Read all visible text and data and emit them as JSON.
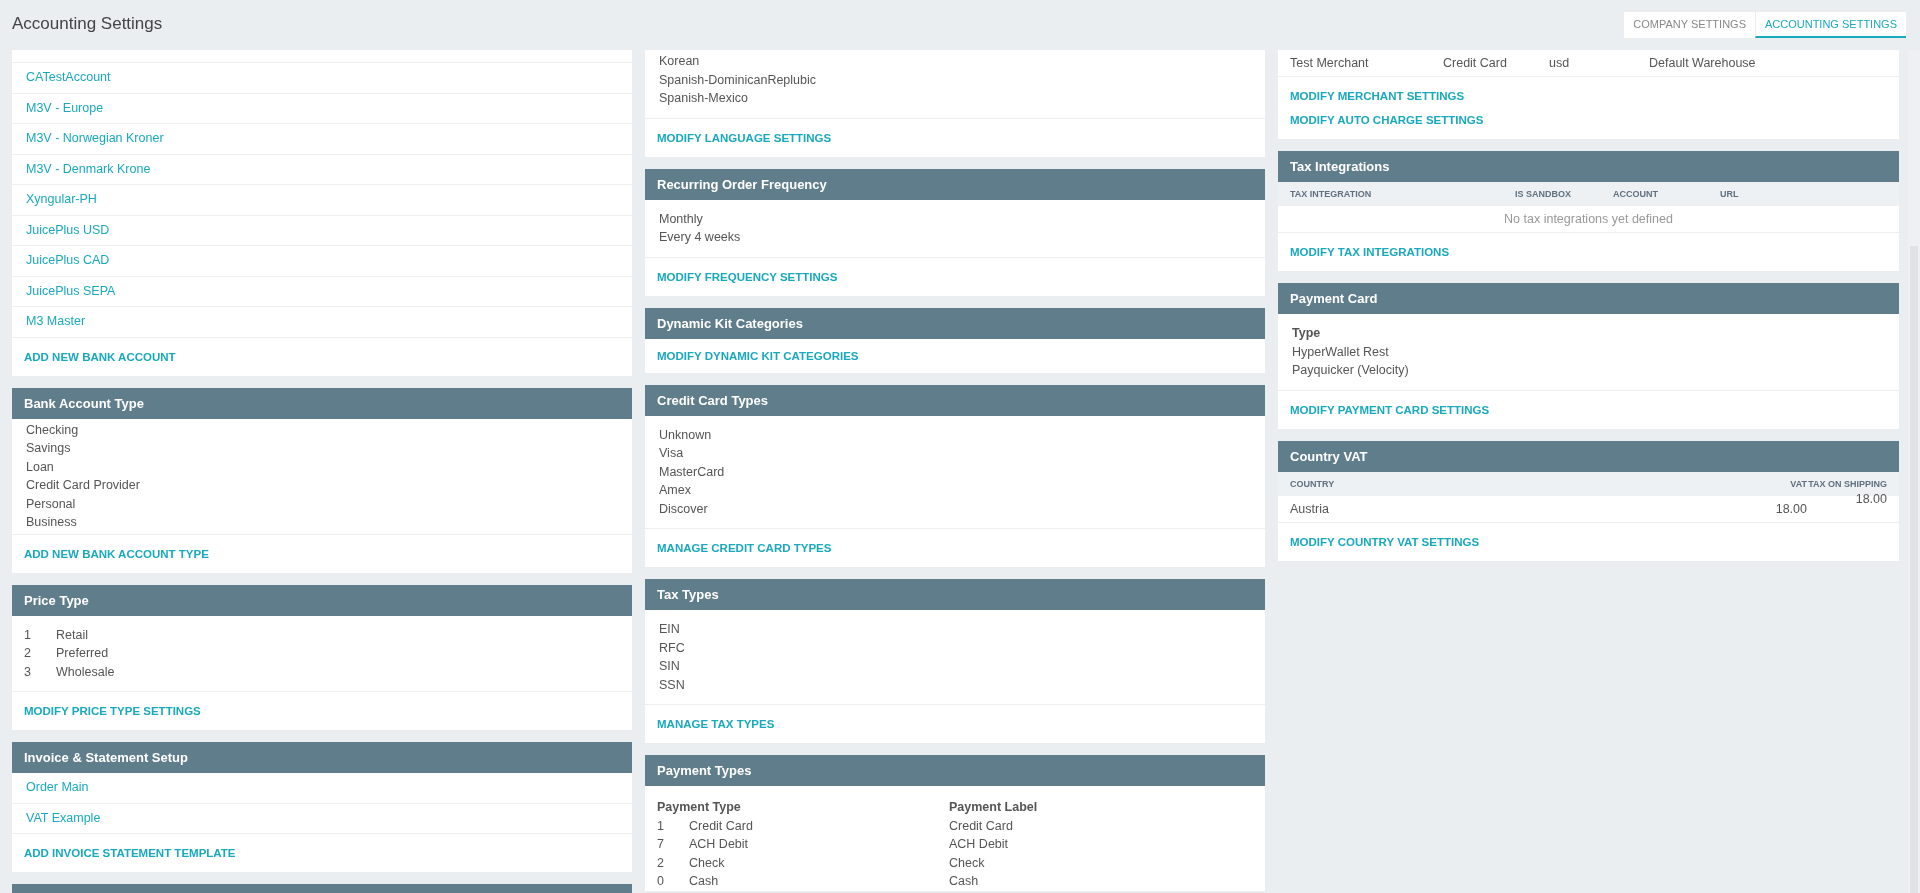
{
  "title": "Accounting Settings",
  "tabs": [
    {
      "label": "COMPANY SETTINGS",
      "selected": false
    },
    {
      "label": "ACCOUNTING SETTINGS",
      "selected": true
    }
  ],
  "columns": [
    {
      "panels": [
        {
          "kind": "links",
          "items": [
            "CATestAccount",
            "M3V - Europe",
            "M3V - Norwegian Kroner",
            "M3V - Denmark Krone",
            "Xyngular-PH",
            "JuicePlus USD",
            "JuicePlus CAD",
            "JuicePlus SEPA",
            "M3 Master"
          ],
          "actions": [
            "ADD NEW BANK ACCOUNT"
          ]
        },
        {
          "title": "Bank Account Type",
          "kind": "lines",
          "items": [
            "Checking",
            "Savings",
            "Loan",
            "Credit Card Provider",
            "Personal",
            "Business"
          ],
          "actions": [
            "ADD NEW BANK ACCOUNT TYPE"
          ]
        },
        {
          "title": "Price Type",
          "kind": "numbered",
          "rows": [
            {
              "code": "1",
              "name": "Retail"
            },
            {
              "code": "2",
              "name": "Preferred"
            },
            {
              "code": "3",
              "name": "Wholesale"
            }
          ],
          "actions": [
            "MODIFY PRICE TYPE SETTINGS"
          ]
        },
        {
          "title": "Invoice & Statement Setup",
          "kind": "links",
          "items": [
            "Order Main",
            "VAT Example"
          ],
          "actions": [
            "ADD INVOICE STATEMENT TEMPLATE"
          ]
        },
        {
          "kind": "stub"
        }
      ]
    },
    {
      "panels": [
        {
          "kind": "lines",
          "items": [
            "Korean",
            "Spanish-DominicanReplubic",
            "Spanish-Mexico"
          ],
          "actions": [
            "MODIFY LANGUAGE SETTINGS"
          ]
        },
        {
          "title": "Recurring Order Frequency",
          "kind": "lines",
          "items": [
            "Monthly",
            "Every 4 weeks"
          ],
          "actions": [
            "MODIFY FREQUENCY SETTINGS"
          ]
        },
        {
          "title": "Dynamic Kit Categories",
          "kind": "none",
          "actions": [
            "MODIFY DYNAMIC KIT CATEGORIES"
          ]
        },
        {
          "title": "Credit Card Types",
          "kind": "lines",
          "items": [
            "Unknown",
            "Visa",
            "MasterCard",
            "Amex",
            "Discover"
          ],
          "actions": [
            "MANAGE CREDIT CARD TYPES"
          ]
        },
        {
          "title": "Tax Types",
          "kind": "lines",
          "items": [
            "EIN",
            "RFC",
            "SIN",
            "SSN"
          ],
          "actions": [
            "MANAGE TAX TYPES"
          ]
        },
        {
          "title": "Payment Types",
          "kind": "typed",
          "columns": [
            "Payment Type",
            "Payment Label"
          ],
          "rows": [
            {
              "code": "1",
              "name": "Credit Card",
              "label": "Credit Card"
            },
            {
              "code": "7",
              "name": "ACH Debit",
              "label": "ACH Debit"
            },
            {
              "code": "2",
              "name": "Check",
              "label": "Check"
            },
            {
              "code": "0",
              "name": "Cash",
              "label": "Cash"
            }
          ]
        }
      ]
    },
    {
      "panels": [
        {
          "kind": "merchant-table",
          "rows": [
            [
              "Test Merchant",
              "Credit Card",
              "usd",
              "Default Warehouse"
            ]
          ],
          "actions": [
            "MODIFY MERCHANT SETTINGS",
            "MODIFY AUTO CHARGE SETTINGS"
          ]
        },
        {
          "title": "Tax Integrations",
          "kind": "integration-table",
          "columns": [
            "TAX INTEGRATION",
            "IS SANDBOX",
            "ACCOUNT",
            "URL"
          ],
          "empty_text": "No tax integrations yet defined",
          "actions": [
            "MODIFY TAX INTEGRATIONS"
          ]
        },
        {
          "title": "Payment Card",
          "kind": "lines",
          "heading": "Type",
          "items": [
            "HyperWallet Rest",
            "Payquicker (Velocity)"
          ],
          "actions": [
            "MODIFY PAYMENT CARD SETTINGS"
          ]
        },
        {
          "title": "Country VAT",
          "kind": "vat-table",
          "columns": [
            "COUNTRY",
            "VAT",
            "TAX ON SHIPPING"
          ],
          "rows": [
            [
              "Austria",
              "18.00",
              "18.00"
            ]
          ],
          "actions": [
            "MODIFY COUNTRY VAT SETTINGS"
          ]
        }
      ]
    }
  ]
}
